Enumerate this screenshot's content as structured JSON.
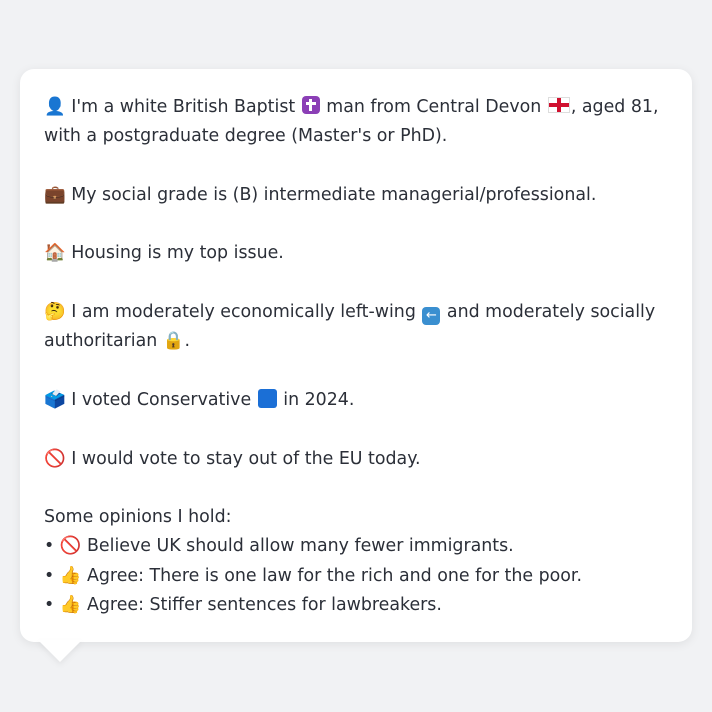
{
  "profile": {
    "intro_a": "I'm a white British Baptist",
    "intro_b": "man from Central Devon",
    "intro_c": ", aged 81, with a postgraduate degree (Master's or PhD).",
    "social_grade": "My social grade is (B) intermediate managerial/professional.",
    "top_issue": "Housing is my top issue.",
    "ideology_a": "I am moderately economically left-wing",
    "ideology_b": "and moderately socially authoritarian",
    "ideology_c": ".",
    "vote_a": "I voted Conservative",
    "vote_b": "in 2024.",
    "eu": "I would vote to stay out of the EU today.",
    "opinions_header": "Some opinions I hold:",
    "opinions": [
      "Believe UK should allow many fewer immigrants.",
      "Agree: There is one law for the rich and one for the poor.",
      "Agree: Stiffer sentences for lawbreakers."
    ]
  },
  "icons": {
    "person": "👤",
    "briefcase": "💼",
    "house": "🏠",
    "thinking": "🤔",
    "lock": "🔒",
    "ballot": "🗳️",
    "no_entry": "🚫",
    "thumbs_up": "👍",
    "bullet": "•"
  },
  "colors": {
    "background": "#f1f2f4",
    "card": "#ffffff",
    "text": "#2b2f38",
    "conservative_blue": "#1b6fd6",
    "england_red": "#d0102f"
  }
}
